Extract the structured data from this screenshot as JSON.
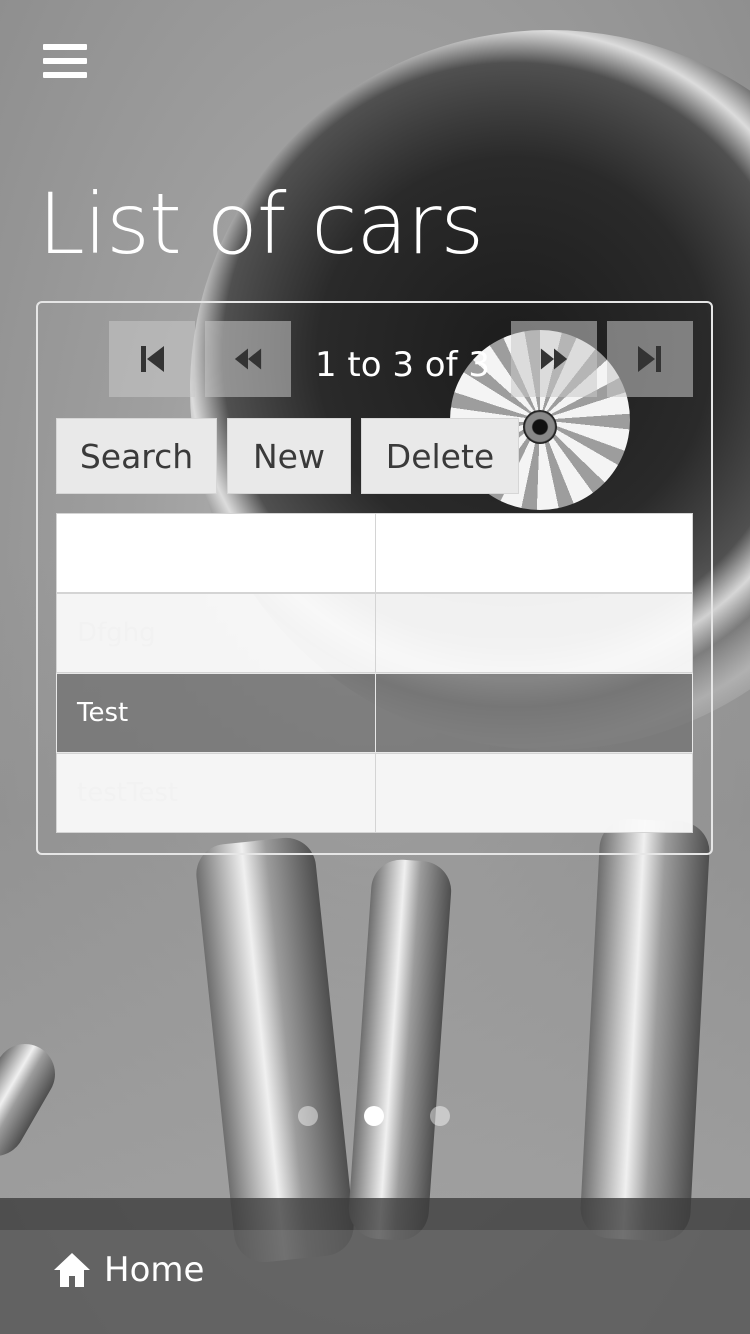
{
  "title": "List of cars",
  "pager": {
    "info": "1 to 3 of 3",
    "first_icon": "skip-first-icon",
    "prev_icon": "rewind-icon",
    "next_icon": "fast-forward-icon",
    "last_icon": "skip-last-icon"
  },
  "actions": {
    "search": "Search",
    "new": "New",
    "delete": "Delete"
  },
  "rows": [
    {
      "name": "",
      "value": ""
    },
    {
      "name": "Dfghg",
      "value": ""
    },
    {
      "name": "Test",
      "value": ""
    },
    {
      "name": "testTest",
      "value": ""
    }
  ],
  "selected_row": "Test",
  "carousel": {
    "count": 3,
    "active": 2
  },
  "footer": {
    "home_label": "Home",
    "home_icon": "home-icon"
  },
  "colors": {
    "accent": "#ffffff",
    "selected_row": "#737373",
    "button_bg": "#e9e9e9"
  }
}
